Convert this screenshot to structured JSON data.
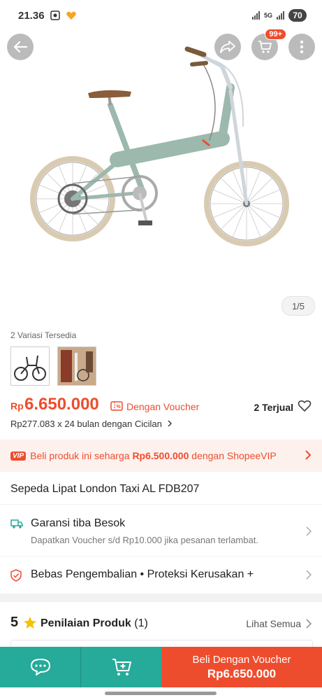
{
  "status": {
    "time": "21.36",
    "network": "5G",
    "battery": "70"
  },
  "header": {
    "cart_badge": "99+"
  },
  "gallery": {
    "counter": "1/5"
  },
  "variants": {
    "label": "2 Variasi Tersedia"
  },
  "price": {
    "currency": "Rp",
    "value": "6.650.000",
    "voucher_label": "Dengan Voucher",
    "sold": "2 Terjual",
    "installment": "Rp277.083 x 24 bulan dengan Cicilan"
  },
  "vip": {
    "badge": "VIP",
    "text": "Beli produk ini seharga ",
    "price": "Rp6.500.000",
    "suffix": " dengan ShopeeVIP"
  },
  "product": {
    "title": "Sepeda Lipat London Taxi AL FDB207"
  },
  "shipping": {
    "title": "Garansi tiba Besok",
    "subtitle": "Dapatkan Voucher s/d Rp10.000 jika pesanan terlambat."
  },
  "returns": {
    "label": "Bebas Pengembalian  •  Proteksi Kerusakan +"
  },
  "rating": {
    "score": "5",
    "title": "Penilaian Produk",
    "count": "(1)",
    "see_all": "Lihat Semua"
  },
  "bottom": {
    "buy_label": "Beli Dengan Voucher",
    "buy_price": "Rp6.650.000"
  },
  "colors": {
    "accent": "#ee4d2d",
    "teal": "#26aa99",
    "bike": "#9db8ad",
    "tire": "#d9cbb2"
  }
}
